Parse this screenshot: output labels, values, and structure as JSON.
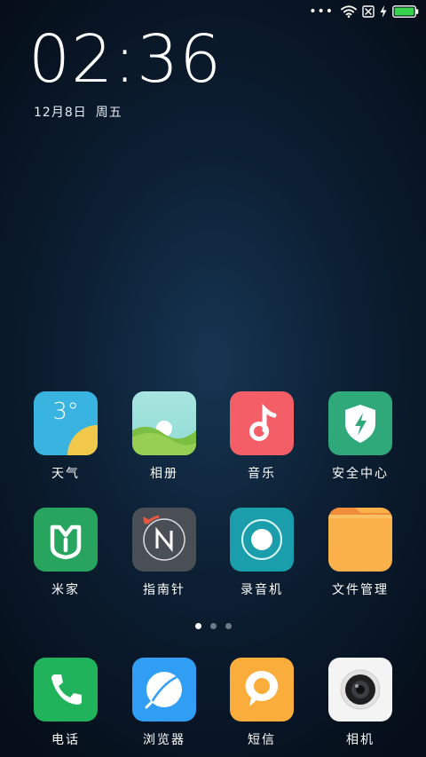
{
  "status": {
    "dots": "•••"
  },
  "lock": {
    "time": "02:36",
    "date": "12月8日",
    "weekday": "周五"
  },
  "weather": {
    "temp": "3°"
  },
  "apps_row1": [
    {
      "label": "天气"
    },
    {
      "label": "相册"
    },
    {
      "label": "音乐"
    },
    {
      "label": "安全中心"
    }
  ],
  "apps_row2": [
    {
      "label": "米家"
    },
    {
      "label": "指南针"
    },
    {
      "label": "录音机"
    },
    {
      "label": "文件管理"
    }
  ],
  "dock": [
    {
      "label": "电话"
    },
    {
      "label": "浏览器"
    },
    {
      "label": "短信"
    },
    {
      "label": "相机"
    }
  ],
  "pages": {
    "count": 3,
    "active": 1
  },
  "colors": {
    "weather": "#39b4e0",
    "gallery": "#9fe3de",
    "music": "#f45e67",
    "security": "#2fa97a",
    "mijia": "#27a55f",
    "compass": "#4a4f55",
    "recorder": "#1a9eac",
    "files": "#fbb14a",
    "phone": "#21b35b",
    "browser": "#2f9ef4",
    "sms": "#fbad3b",
    "camera": "#f4f4f4"
  }
}
